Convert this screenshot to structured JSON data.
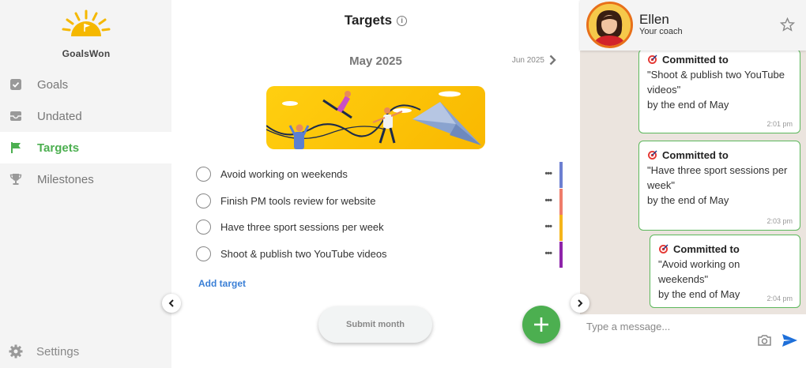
{
  "app": {
    "logo_text": "GoalsWon"
  },
  "sidebar": {
    "items": [
      {
        "label": "Goals",
        "icon": "checkbox-icon",
        "active": false
      },
      {
        "label": "Undated",
        "icon": "inbox-icon",
        "active": false
      },
      {
        "label": "Targets",
        "icon": "flag-icon",
        "active": true
      },
      {
        "label": "Milestones",
        "icon": "trophy-icon",
        "active": false
      }
    ],
    "settings_label": "Settings"
  },
  "main": {
    "title": "Targets",
    "month": "May 2025",
    "next_month": "Jun 2025",
    "targets": [
      {
        "text": "Avoid working on weekends",
        "color": "#6c7fd1"
      },
      {
        "text": "Finish PM tools review for website",
        "color": "#ef7c6a"
      },
      {
        "text": "Have three sport sessions per week",
        "color": "#f5b51a"
      },
      {
        "text": "Shoot & publish two YouTube videos",
        "color": "#8e24aa"
      }
    ],
    "add_target_label": "Add target",
    "submit_label": "Submit month",
    "accent": "#4caf50"
  },
  "chat": {
    "coach_name": "Ellen",
    "coach_role": "Your coach",
    "messages": [
      {
        "heading": "Committed to",
        "line1": "\"Shoot & publish two YouTube",
        "line2": "videos\"",
        "line3": "by the end of May",
        "time": "2:01 pm"
      },
      {
        "heading": "Committed to",
        "line1": "\"Have three sport sessions per",
        "line2": "week\"",
        "line3": "by the end of May",
        "time": "2:03 pm"
      },
      {
        "heading": "Committed to",
        "line1": "\"Avoid working on weekends\"",
        "line2": "by the end of May",
        "time": "2:04 pm"
      }
    ],
    "input_placeholder": "Type a message..."
  }
}
